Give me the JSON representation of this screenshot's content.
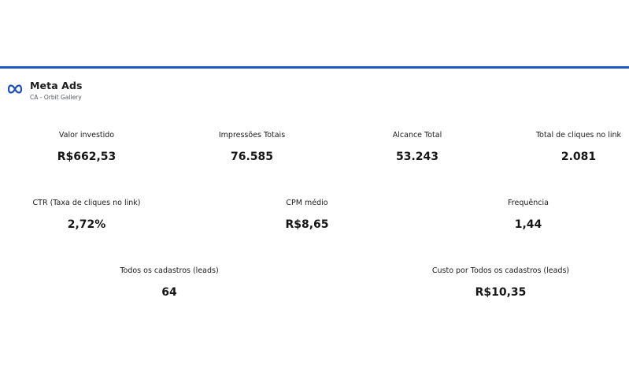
{
  "header": {
    "title": "Meta Ads",
    "subtitle": "CA - Orbit Gallery",
    "accent_color": "#2057c8",
    "logo_icon": "meta-infinity-logo"
  },
  "metrics_row1": [
    {
      "label": "Valor investido",
      "value": "R$662,53"
    },
    {
      "label": "Impressões Totais",
      "value": "76.585"
    },
    {
      "label": "Alcance Total",
      "value": "53.243"
    },
    {
      "label": "Total de cliques no link",
      "value": "2.081"
    }
  ],
  "metrics_row2": [
    {
      "label": "CTR (Taxa de cliques no link)",
      "value": "2,72%"
    },
    {
      "label": "CPM médio",
      "value": "R$8,65"
    },
    {
      "label": "Frequência",
      "value": "1,44"
    }
  ],
  "metrics_row3": [
    {
      "label": "Todos os cadastros (leads)",
      "value": "64"
    },
    {
      "label": "Custo por Todos os cadastros (leads)",
      "value": "R$10,35"
    }
  ]
}
